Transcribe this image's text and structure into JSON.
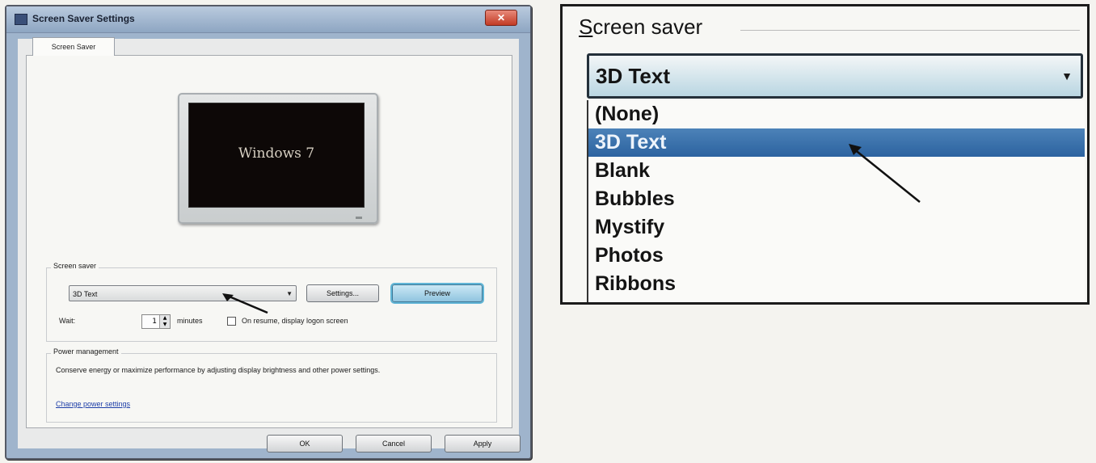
{
  "dialog": {
    "title": "Screen Saver Settings",
    "close_label": "✕",
    "tab_label": "Screen Saver",
    "preview_text": "Windows 7",
    "screensaver_group_label": "Screen saver",
    "selected_screensaver": "3D Text",
    "settings_button": "Settings...",
    "preview_button": "Preview",
    "wait_label": "Wait:",
    "wait_value": "1",
    "minutes_label": "minutes",
    "resume_label": "On resume, display logon screen",
    "resume_checked": false,
    "power_group_label": "Power management",
    "power_description": "Conserve energy or maximize performance by adjusting display brightness and other power settings.",
    "power_link": "Change power settings",
    "ok_button": "OK",
    "cancel_button": "Cancel",
    "apply_button": "Apply"
  },
  "zoom": {
    "label_mnemonic": "S",
    "label_rest": "creen saver",
    "selected": "3D Text",
    "options": [
      "(None)",
      "3D Text",
      "Blank",
      "Bubbles",
      "Mystify",
      "Photos",
      "Ribbons"
    ],
    "selected_index": 1
  },
  "colors": {
    "selection_highlight": "#2c63a0",
    "preview_screen": "#0d0807",
    "close_button": "#c23b25"
  }
}
